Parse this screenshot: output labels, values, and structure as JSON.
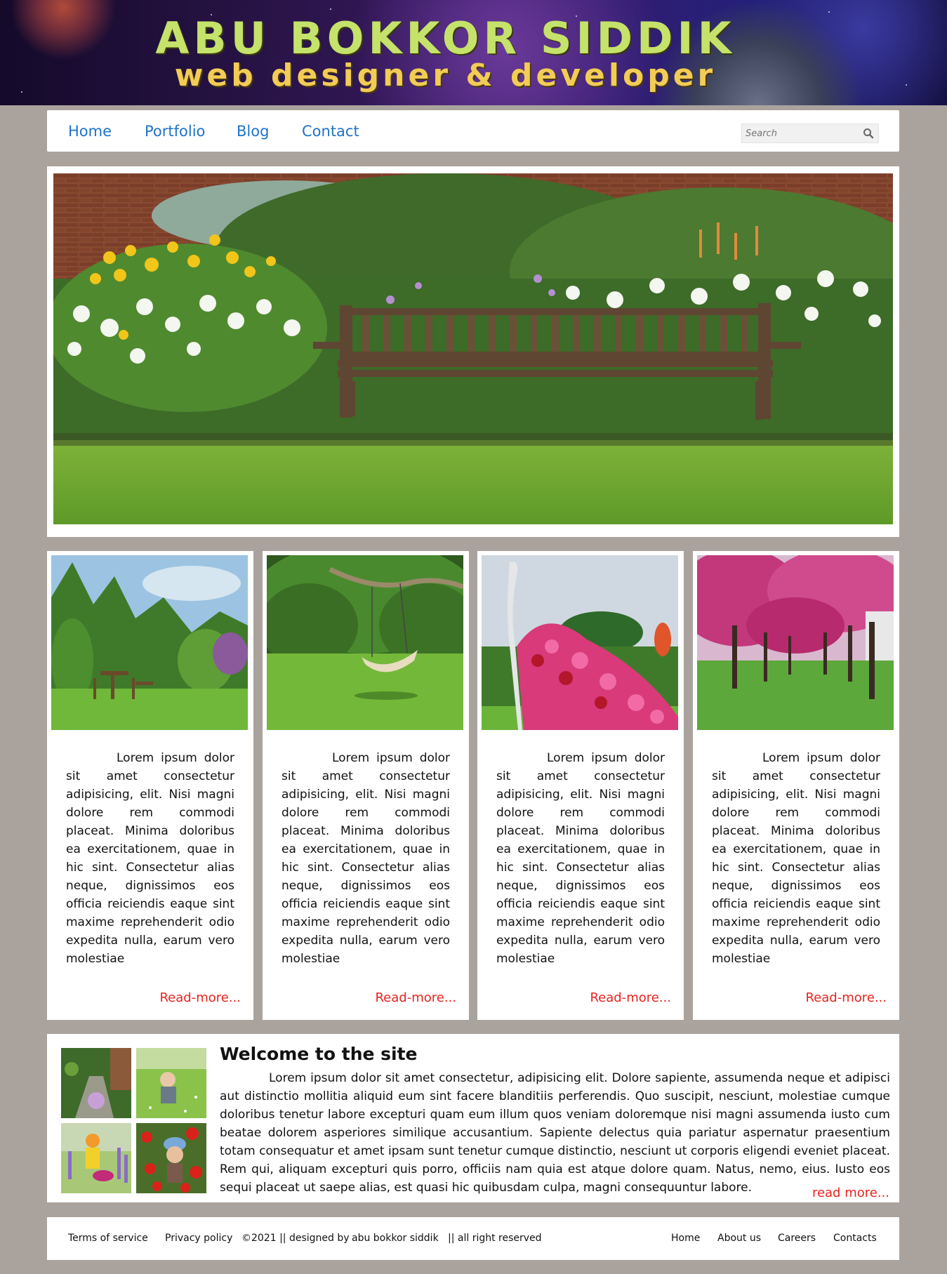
{
  "header": {
    "title": "ABU BOKKOR SIDDIK",
    "subtitle": "web designer & developer"
  },
  "nav": {
    "links": [
      "Home",
      "Portfolio",
      "Blog",
      "Contact"
    ],
    "search_placeholder": "Search"
  },
  "cards": [
    {
      "text": "Lorem ipsum dolor sit amet consectetur adipisicing, elit. Nisi magni dolore rem commodi placeat. Minima doloribus ea exercitationem, quae in hic sint. Consectetur alias neque, dignissimos eos officia reiciendis eaque sint maxime reprehenderit odio expedita nulla, earum vero molestiae",
      "more": "Read-more..."
    },
    {
      "text": "Lorem ipsum dolor sit amet consectetur adipisicing, elit. Nisi magni dolore rem commodi placeat. Minima doloribus ea exercitationem, quae in hic sint. Consectetur alias neque, dignissimos eos officia reiciendis eaque sint maxime reprehenderit odio expedita nulla, earum vero molestiae",
      "more": "Read-more..."
    },
    {
      "text": "Lorem ipsum dolor sit amet consectetur adipisicing, elit. Nisi magni dolore rem commodi placeat. Minima doloribus ea exercitationem, quae in hic sint. Consectetur alias neque, dignissimos eos officia reiciendis eaque sint maxime reprehenderit odio expedita nulla, earum vero molestiae",
      "more": "Read-more..."
    },
    {
      "text": "Lorem ipsum dolor sit amet consectetur adipisicing, elit. Nisi magni dolore rem commodi placeat. Minima doloribus ea exercitationem, quae in hic sint. Consectetur alias neque, dignissimos eos officia reiciendis eaque sint maxime reprehenderit odio expedita nulla, earum vero molestiae",
      "more": "Read-more..."
    }
  ],
  "welcome": {
    "title": "Welcome to the site",
    "text": "Lorem ipsum dolor sit amet consectetur, adipisicing elit. Dolore sapiente, assumenda neque et adipisci aut distinctio mollitia aliquid eum sint facere blanditiis perferendis. Quo suscipit, nesciunt, molestiae cumque doloribus tenetur labore excepturi quam eum illum quos veniam doloremque nisi magni assumenda iusto cum beatae dolorem asperiores similique accusantium. Sapiente delectus quia pariatur aspernatur praesentium totam consequatur et amet ipsam sunt tenetur cumque distinctio, nesciunt ut corporis eligendi eveniet placeat. Rem qui, aliquam excepturi quis porro, officiis nam quia est atque dolore quam. Natus, nemo, eius. Iusto eos sequi placeat ut saepe alias, est quasi hic quibusdam culpa, magni consequuntur labore.",
    "more": "read more..."
  },
  "footer": {
    "terms": "Terms of service",
    "privacy": "Privacy policy",
    "copyright": "©2021 || designed by",
    "author": "abu bokkor siddik",
    "rights": "|| all right reserved",
    "links": [
      "Home",
      "About us",
      "Careers",
      "Contacts"
    ]
  },
  "colors": {
    "page_bg": "#aaa39d",
    "link_blue": "#1f73c9",
    "read_more_red": "#e8231d",
    "title_green": "#c5e26a",
    "subtitle_yellow": "#f2cc55"
  },
  "icons": [
    "search-icon"
  ]
}
